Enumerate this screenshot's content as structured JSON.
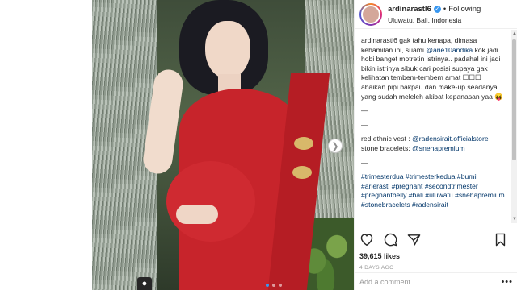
{
  "post": {
    "username": "ardinarastl6",
    "follow_status": "Following",
    "separator": "•",
    "location": "Uluwatu, Bali, Indonesia"
  },
  "caption": {
    "author": "ardinarastl6",
    "text_part1": " gak tahu kenapa, dimasa kehamilan ini, suami ",
    "mention_husband": "@arie10andika",
    "text_part2": " kok jadi hobi banget motretin istrinya.. padahal ini jadi bikin istrinya sibuk cari posisi supaya gak kelihatan tembem-tembem amat ☐☐☐ abaikan pipi bakpau dan make-up seadanya yang sudah meleleh akibat kepanasan yaa 😝",
    "divider1": "—",
    "divider2": "—",
    "vest_label": "red ethnic vest : ",
    "vest_mention": "@radensirait.officialstore",
    "bracelet_label": "stone bracelets: ",
    "bracelet_mention": "@snehapremium",
    "divider3": "—",
    "hashtags": "#trimesterdua #trimesterkedua #bumil #arierasti #pregnant #secondtrimester #pregnantbelly #bali #uluwatu #snehapremium #stonebracelets #radensirait"
  },
  "stats": {
    "likes": "39,615 likes",
    "time_ago": "4 DAYS AGO"
  },
  "comment": {
    "placeholder": "Add a comment...",
    "more": "•••"
  },
  "icons": {
    "like": "heart-icon",
    "comment": "comment-icon",
    "share": "share-icon",
    "save": "bookmark-icon",
    "verified": "verified-badge-icon",
    "next": "chevron-right-icon"
  },
  "colors": {
    "link": "#003569",
    "verified": "#3897f0",
    "text": "#262626",
    "muted": "#999999"
  }
}
